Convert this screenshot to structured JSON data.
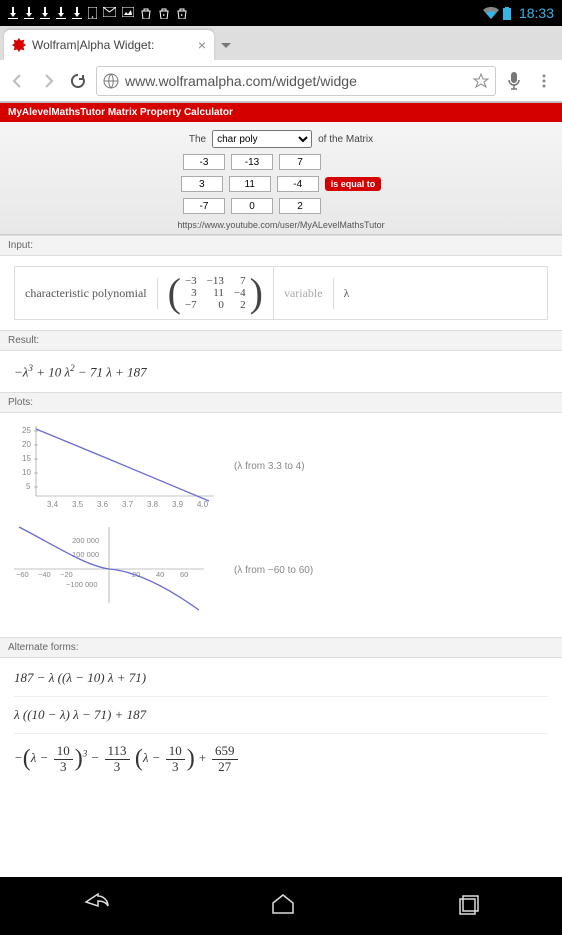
{
  "statusbar": {
    "time": "18:33"
  },
  "browser": {
    "tab_title": "Wolfram|Alpha Widget:",
    "url": "www.wolframalpha.com/widget/widge"
  },
  "widget": {
    "title": "MyAlevelMathsTutor Matrix Property Calculator",
    "label_the": "The",
    "property": "char poly",
    "label_of": "of the Matrix",
    "matrix": [
      [
        "-3",
        "-13",
        "7"
      ],
      [
        "3",
        "11",
        "-4"
      ],
      [
        "-7",
        "0",
        "2"
      ]
    ],
    "equals_label": "is equal to",
    "link": "https://www.youtube.com/user/MyALevelMathsTutor"
  },
  "sections": {
    "input": "Input:",
    "result": "Result:",
    "plots": "Plots:",
    "altforms": "Alternate forms:"
  },
  "input_pod": {
    "label": "characteristic polynomial",
    "var_label": "variable",
    "var": "λ"
  },
  "result": "−λ³ + 10 λ² − 71 λ + 187",
  "chart_data": [
    {
      "type": "line",
      "x": [
        3.3,
        3.4,
        3.5,
        3.6,
        3.7,
        3.8,
        3.9,
        4.0
      ],
      "y": [
        25.2,
        21.3,
        17.3,
        13.2,
        9.0,
        4.7,
        0.3,
        -4.2
      ],
      "ylim": [
        0,
        25
      ],
      "yticks": [
        5,
        10,
        15,
        20,
        25
      ],
      "xticks": [
        3.4,
        3.5,
        3.6,
        3.7,
        3.8,
        3.9,
        4.0
      ],
      "caption": "(λ  from 3.3 to 4)"
    },
    {
      "type": "line",
      "x": [
        -60,
        -50,
        -40,
        -30,
        -20,
        -10,
        0,
        10,
        20,
        30,
        40,
        50,
        60
      ],
      "y": [
        256247,
        154737,
        85787,
        40397,
        13567,
        2297,
        187,
        -763,
        -5633,
        -22003,
        -57563,
        -120003,
        -217013
      ],
      "yticks": [
        -100000,
        100000,
        200000
      ],
      "xticks": [
        -60,
        -40,
        -20,
        20,
        40,
        60
      ],
      "caption": "(λ  from −60 to 60)"
    }
  ],
  "altforms": [
    "187 − λ ((λ − 10) λ + 71)",
    "λ ((10 − λ) λ − 71) + 187"
  ],
  "altform3": {
    "a": "10",
    "b": "3",
    "c": "113",
    "d": "3",
    "e": "10",
    "f": "3",
    "g": "659",
    "h": "27"
  }
}
